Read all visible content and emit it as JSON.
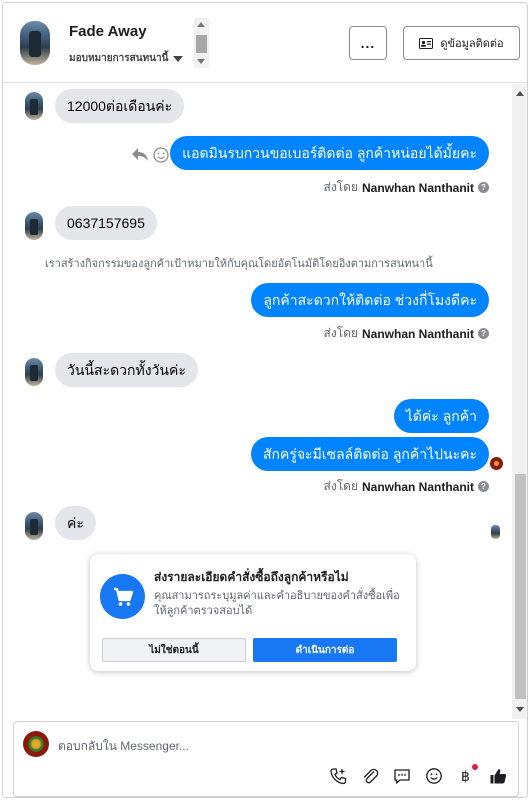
{
  "header": {
    "contact_name": "Fade Away",
    "assign_label": "มอบหมายการสนทนานี้",
    "more_label": "...",
    "view_contact_label": "ดูข้อมูลติดต่อ"
  },
  "messages": [
    {
      "dir": "in",
      "text": "12000ต่อเดือนค่ะ"
    },
    {
      "dir": "out",
      "text": "แอดมินรบกวนขอเบอร์ติดต่อ ลูกค้าหน่อยได้มั้ยคะ"
    },
    {
      "dir": "sent_by",
      "prefix": "ส่งโดย",
      "name": "Nanwhan Nanthanit"
    },
    {
      "dir": "in",
      "text": "0637157695"
    },
    {
      "dir": "system",
      "text": "เราสร้างกิจกรรมของลูกค้าเป้าหมายให้กับคุณโดยอัตโนมัติโดยอิงตามการสนทนานี้"
    },
    {
      "dir": "out",
      "text": "ลูกค้าสะดวกให้ติดต่อ ช่วงกี่โมงดีคะ"
    },
    {
      "dir": "sent_by",
      "prefix": "ส่งโดย",
      "name": "Nanwhan Nanthanit"
    },
    {
      "dir": "in",
      "text": "วันนี้สะดวกทั้งวันค่ะ"
    },
    {
      "dir": "out",
      "text": "ได้ค่ะ ลูกค้า"
    },
    {
      "dir": "out",
      "text": "สักครู่จะมีเซลล์ติดต่อ ลูกค้าไปนะคะ"
    },
    {
      "dir": "sent_by",
      "prefix": "ส่งโดย",
      "name": "Nanwhan Nanthanit"
    },
    {
      "dir": "in",
      "text": "ค่ะ"
    }
  ],
  "help_mark": "?",
  "prompt_card": {
    "title": "ส่งรายละเอียดคำสั่งซื้อถึงลูกค้าหรือไม่",
    "description": "คุณสามารถระบุมูลค่าและคำอธิบายของคำสั่งซื้อเพื่อให้ลูกค้าตรวจสอบได้",
    "no_label": "ไม่ใช่ตอนนี้",
    "continue_label": "ดำเนินการต่อ",
    "icon": "shopping-cart-icon"
  },
  "composer": {
    "placeholder": "ตอบกลับใน Messenger...",
    "tools": [
      "phone-add-icon",
      "paperclip-icon",
      "chat-bubble-icon",
      "smiley-icon",
      "baht-icon",
      "thumbs-up-icon"
    ]
  },
  "colors": {
    "outgoing": "#0084ff",
    "incoming": "#e4e6eb",
    "accent": "#1877f2"
  }
}
